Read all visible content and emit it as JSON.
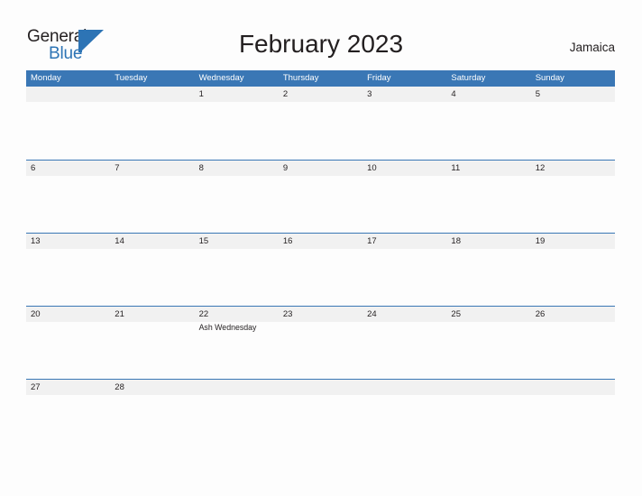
{
  "brand": {
    "name_part1": "General",
    "name_part2": "Blue",
    "mark_icon": "blue-flag-triangle-icon",
    "color_primary": "#2d74b5",
    "color_text": "#231f20"
  },
  "header": {
    "title": "February 2023",
    "country": "Jamaica"
  },
  "calendar": {
    "month": "February",
    "year": "2023",
    "header_bg": "#3a77b5",
    "band_bg": "#f1f1f1",
    "border_color": "#3a77b5",
    "day_names": [
      "Monday",
      "Tuesday",
      "Wednesday",
      "Thursday",
      "Friday",
      "Saturday",
      "Sunday"
    ],
    "weeks": [
      {
        "days": [
          {
            "num": "",
            "events": []
          },
          {
            "num": "",
            "events": []
          },
          {
            "num": "1",
            "events": []
          },
          {
            "num": "2",
            "events": []
          },
          {
            "num": "3",
            "events": []
          },
          {
            "num": "4",
            "events": []
          },
          {
            "num": "5",
            "events": []
          }
        ]
      },
      {
        "days": [
          {
            "num": "6",
            "events": []
          },
          {
            "num": "7",
            "events": []
          },
          {
            "num": "8",
            "events": []
          },
          {
            "num": "9",
            "events": []
          },
          {
            "num": "10",
            "events": []
          },
          {
            "num": "11",
            "events": []
          },
          {
            "num": "12",
            "events": []
          }
        ]
      },
      {
        "days": [
          {
            "num": "13",
            "events": []
          },
          {
            "num": "14",
            "events": []
          },
          {
            "num": "15",
            "events": []
          },
          {
            "num": "16",
            "events": []
          },
          {
            "num": "17",
            "events": []
          },
          {
            "num": "18",
            "events": []
          },
          {
            "num": "19",
            "events": []
          }
        ]
      },
      {
        "days": [
          {
            "num": "20",
            "events": []
          },
          {
            "num": "21",
            "events": []
          },
          {
            "num": "22",
            "events": [
              "Ash Wednesday"
            ]
          },
          {
            "num": "23",
            "events": []
          },
          {
            "num": "24",
            "events": []
          },
          {
            "num": "25",
            "events": []
          },
          {
            "num": "26",
            "events": []
          }
        ]
      },
      {
        "days": [
          {
            "num": "27",
            "events": []
          },
          {
            "num": "28",
            "events": []
          },
          {
            "num": "",
            "events": []
          },
          {
            "num": "",
            "events": []
          },
          {
            "num": "",
            "events": []
          },
          {
            "num": "",
            "events": []
          },
          {
            "num": "",
            "events": []
          }
        ]
      }
    ]
  }
}
